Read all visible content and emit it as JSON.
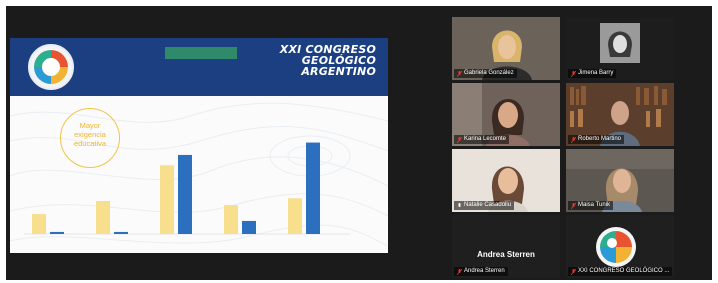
{
  "slide": {
    "title_lines": [
      "XXI CONGRESO",
      "GEOLÓGICO",
      "ARGENTINO"
    ],
    "callout_lines": [
      "Mayor",
      "exigencia",
      "educativa"
    ],
    "chart_data": {
      "type": "bar",
      "categories": [
        "",
        "",
        "",
        "",
        ""
      ],
      "series": [
        {
          "name": "",
          "color": "#f8df8e",
          "values": [
            29,
            48,
            100,
            42,
            52
          ]
        },
        {
          "name": "",
          "color": "#2c6fbf",
          "values": [
            3,
            3,
            115,
            19,
            133
          ]
        }
      ],
      "ylim": [
        0,
        160
      ],
      "grid": false
    }
  },
  "participants": [
    {
      "name": "Gabriela González",
      "muted": true
    },
    {
      "name": "Jimena Barry",
      "muted": true
    },
    {
      "name": "Karina Lecomte",
      "muted": true
    },
    {
      "name": "Roberto Martino",
      "muted": true
    },
    {
      "name": "Natalie Casadoliu",
      "muted": false,
      "active": true
    },
    {
      "name": "Maisa Tunik",
      "muted": true
    },
    {
      "name": "Andrea Sterren",
      "display": "Andrea Sterren",
      "muted": true
    },
    {
      "name": "XXI CONGRESO GEOLÓGICO ...",
      "muted": true
    }
  ],
  "colors": {
    "accent_active": "#b6ef3e",
    "mic_muted": "#e03b2f"
  }
}
